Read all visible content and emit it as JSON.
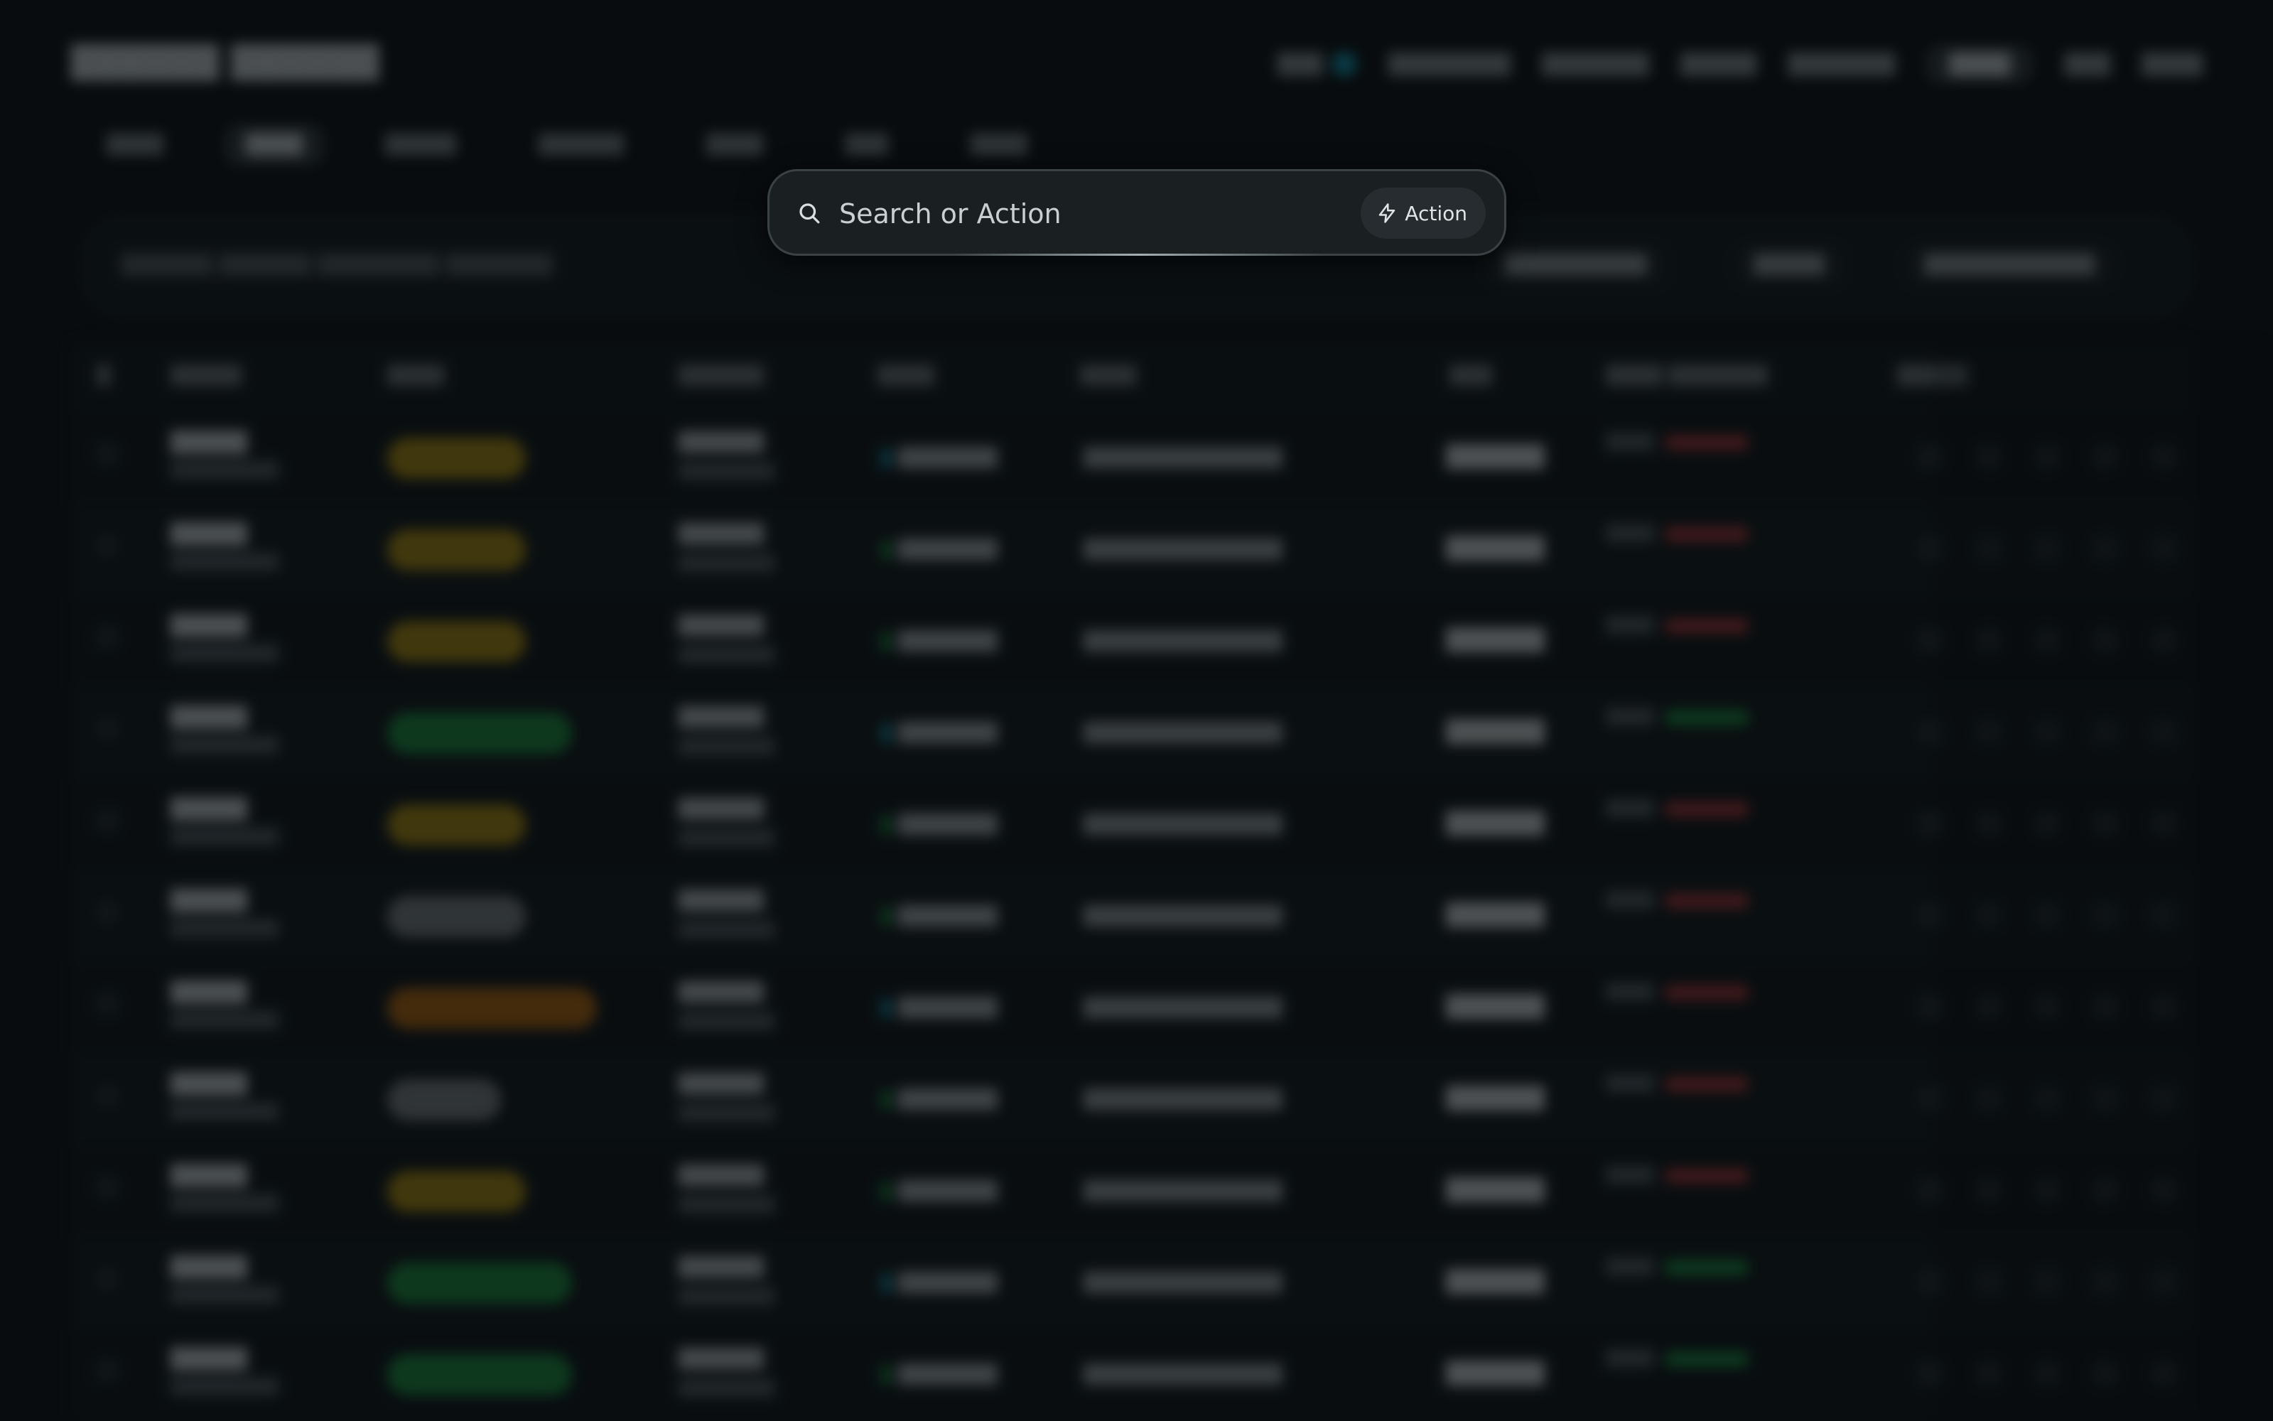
{
  "palette": {
    "placeholder": "Search or Action",
    "action_label": "Action"
  },
  "colors": {
    "status_yellow": "#c7a00e",
    "status_green": "#1fa347",
    "status_gray": "#8e9497",
    "status_orange": "#d1760c",
    "accent_blue": "#18a5c4"
  }
}
